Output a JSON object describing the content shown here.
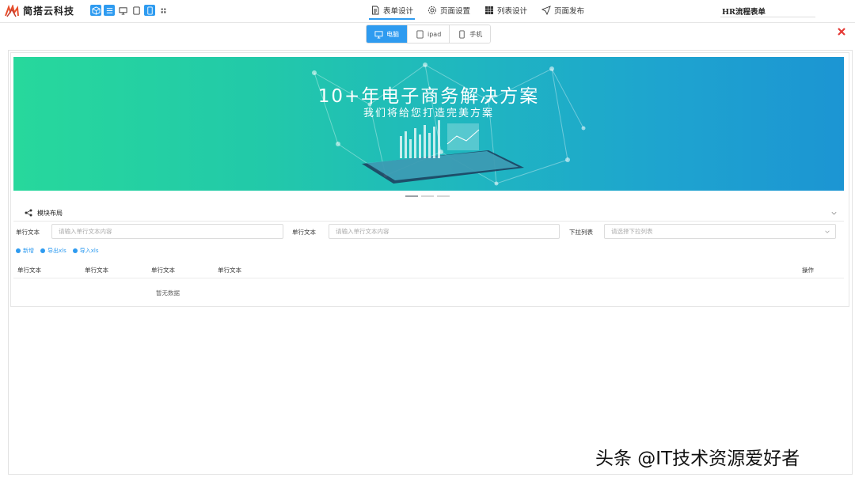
{
  "header": {
    "brand_name": "简搭云科技",
    "tools": [
      {
        "icon": "cube-icon",
        "active": true
      },
      {
        "icon": "align-icon",
        "active": true
      },
      {
        "icon": "monitor-icon",
        "active": false
      },
      {
        "icon": "tablet-icon",
        "active": false
      },
      {
        "icon": "phone-icon",
        "active": true
      },
      {
        "icon": "grid-icon",
        "active": false
      }
    ],
    "nav": [
      {
        "label": "表单设计",
        "icon": "document-icon",
        "active": true
      },
      {
        "label": "页面设置",
        "icon": "gear-icon",
        "active": false
      },
      {
        "label": "列表设计",
        "icon": "grid-icon",
        "active": false
      },
      {
        "label": "页面发布",
        "icon": "send-icon",
        "active": false
      }
    ],
    "form_name": "HR流程表单"
  },
  "devices": [
    {
      "label": "电脑",
      "icon": "monitor-icon",
      "active": true
    },
    {
      "label": "ipad",
      "icon": "tablet-icon",
      "active": false
    },
    {
      "label": "手机",
      "icon": "phone-icon",
      "active": false
    }
  ],
  "banner": {
    "title": "10+年电子商务解决方案",
    "subtitle": "我们将给您打造完美方案"
  },
  "module": {
    "title": "模块布局"
  },
  "fields": [
    {
      "label": "单行文本",
      "placeholder": "请输入单行文本内容"
    },
    {
      "label": "单行文本",
      "placeholder": "请输入单行文本内容"
    },
    {
      "label": "下拉列表",
      "placeholder": "请选择下拉列表"
    }
  ],
  "actions": [
    {
      "label": "新增"
    },
    {
      "label": "导出xls"
    },
    {
      "label": "导入xls"
    }
  ],
  "table": {
    "columns": [
      "单行文本",
      "单行文本",
      "单行文本",
      "单行文本"
    ],
    "op_column": "操作",
    "empty_text": "暂无数据"
  },
  "watermark": "头条 @IT技术资源爱好者",
  "colors": {
    "accent": "#2e9bf0",
    "close": "#e53935",
    "banner_start": "#27d89c",
    "banner_end": "#1c95d3"
  }
}
